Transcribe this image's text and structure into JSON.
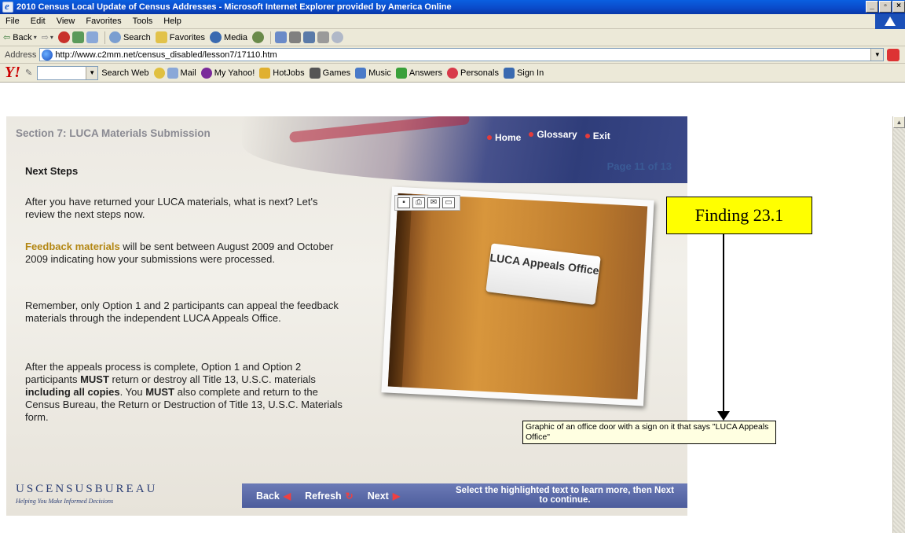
{
  "window": {
    "title": "2010 Census Local Update of Census Addresses - Microsoft Internet Explorer provided by America Online"
  },
  "menu": [
    "File",
    "Edit",
    "View",
    "Favorites",
    "Tools",
    "Help"
  ],
  "toolbar": {
    "back": "Back",
    "search": "Search",
    "favorites": "Favorites",
    "media": "Media"
  },
  "address": {
    "label": "Address",
    "url": "http://www.c2mm.net/census_disabled/lesson7/17110.htm"
  },
  "yahoo": {
    "search_web": "Search Web",
    "mail": "Mail",
    "my_yahoo": "My Yahoo!",
    "hotjobs": "HotJobs",
    "games": "Games",
    "music": "Music",
    "answers": "Answers",
    "personals": "Personals",
    "sign_in": "Sign In"
  },
  "lesson": {
    "section_title": "Section 7: LUCA Materials Submission",
    "nav": {
      "home": "Home",
      "glossary": "Glossary",
      "exit": "Exit"
    },
    "page": "Page 11 of 13",
    "heading": "Next Steps",
    "para1": "After you have returned your LUCA materials, what is next? Let's review the next steps now.",
    "para2_link": "Feedback materials",
    "para2_rest": " will be sent between August 2009 and October 2009 indicating how your submissions were processed.",
    "para3": "Remember, only Option 1 and 2 participants can appeal the feedback materials through the independent LUCA Appeals Office.",
    "para4_a": "After the appeals process is complete, Option 1 and Option 2 participants ",
    "para4_must1": "MUST",
    "para4_b": " return or destroy all Title 13, U.S.C. materials ",
    "para4_copies": "including all copies",
    "para4_c": ". You ",
    "para4_must2": "MUST",
    "para4_d": " also complete and return to the Census Bureau, the Return or Destruction of Title 13, U.S.C. Materials form.",
    "door_sign": "LUCA Appeals Office",
    "logo": "USCENSUSBUREAU",
    "logo_sub": "Helping You Make Informed Decisions",
    "bottom": {
      "back": "Back",
      "refresh": "Refresh",
      "next": "Next",
      "note": "Select the highlighted text to learn more, then Next to continue."
    }
  },
  "annotation": {
    "finding": "Finding 23.1",
    "tooltip": "Graphic of an office door with a sign on it that says \"LUCA Appeals Office\""
  }
}
